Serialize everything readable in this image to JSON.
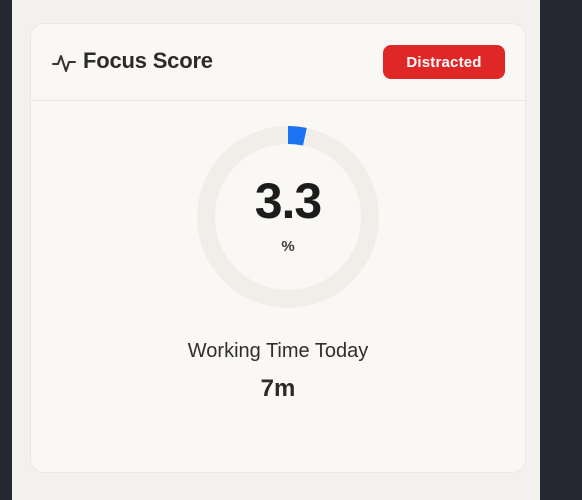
{
  "card": {
    "title": "Focus Score",
    "title_icon": "activity-pulse-icon",
    "status_badge": "Distracted",
    "status_color": "#df2727"
  },
  "focus_score": {
    "value": "3.3",
    "unit": "%",
    "progress_fraction": 0.033,
    "accent_color": "#1a73f0"
  },
  "working_time": {
    "label": "Working Time Today",
    "value": "7m"
  }
}
